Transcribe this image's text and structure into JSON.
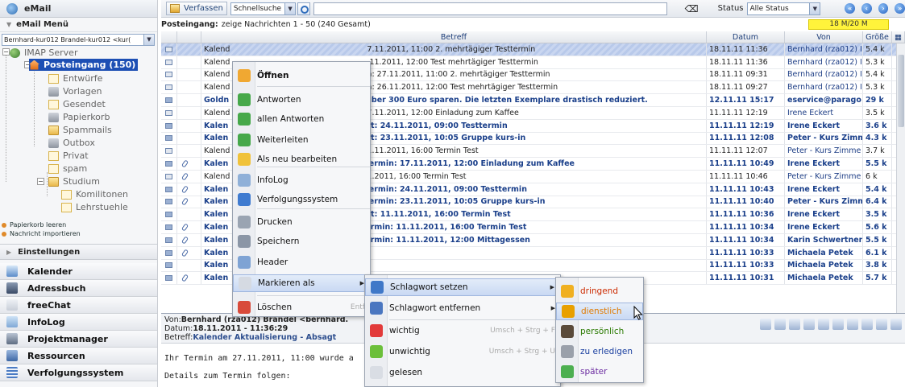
{
  "sidebar": {
    "header": "eMail",
    "menu_title": "eMail Menü",
    "account_select": "Bernhard-kur012 Brandel-kur012 <kur(",
    "tree": {
      "root": "IMAP Server",
      "inbox": "Posteingang (150)",
      "folders": [
        "Entwürfe",
        "Vorlagen",
        "Gesendet",
        "Papierkorb",
        "Spammails",
        "Outbox",
        "Privat",
        "spam",
        "Studium",
        "Komilitonen",
        "Lehrstuehle"
      ]
    },
    "links": [
      "Papierkorb leeren",
      "Nachricht importieren"
    ],
    "settings": "Einstellungen",
    "apps": [
      "Kalender",
      "Adressbuch",
      "freeChat",
      "InfoLog",
      "Projektmanager",
      "Ressourcen",
      "Verfolgungssystem"
    ]
  },
  "toolbar": {
    "compose": "Verfassen",
    "search_mode": "Schnellsuche",
    "status_label": "Status",
    "status_value": "Alle Status"
  },
  "info": {
    "folder": "Posteingang:",
    "range": "zeige Nachrichten 1 - 50 (240 Gesamt)",
    "quota": "18 M/20 M"
  },
  "columns": {
    "subject": "Betreff",
    "date": "Datum",
    "from": "Von",
    "size": "Größe"
  },
  "messages": [
    {
      "s": "Kalend",
      "m": "7.11.2011, 11:00 2. mehrtägiger Testtermin",
      "d": "18.11.11 11:36",
      "f": "Bernhard (rza012) I",
      "z": "5.4 k",
      "unread": false,
      "sel": true,
      "att": false
    },
    {
      "s": "Kalend",
      "m": ".11.2011, 12:00 Test mehrtägiger Testtermin",
      "d": "18.11.11 11:36",
      "f": "Bernhard (rza012) I",
      "z": "5.3 k",
      "unread": false,
      "sel": false,
      "att": false
    },
    {
      "s": "Kalend",
      "m": "n: 27.11.2011, 11:00 2. mehrtägiger Testtermin",
      "d": "18.11.11 09:31",
      "f": "Bernhard (rza012) I",
      "z": "5.4 k",
      "unread": false,
      "sel": false,
      "att": false
    },
    {
      "s": "Kalend",
      "m": "n: 26.11.2011, 12:00 Test mehrtägiger Testtermin",
      "d": "18.11.11 09:27",
      "f": "Bernhard (rza012) I",
      "z": "5.3 k",
      "unread": false,
      "sel": false,
      "att": false
    },
    {
      "s": "Goldn",
      "m": "über 300 Euro sparen. Die letzten Exemplare drastisch reduziert.",
      "d": "12.11.11 15:17",
      "f": "eservice@parago",
      "z": "29 k",
      "unread": true,
      "sel": false,
      "att": false
    },
    {
      "s": "Kalend",
      "m": "7.11.2011, 12:00 Einladung zum Kaffee",
      "d": "11.11.11 12:19",
      "f": "Irene Eckert",
      "z": "3.5 k",
      "unread": false,
      "sel": false,
      "att": false
    },
    {
      "s": "Kalen",
      "m": "gt: 24.11.2011, 09:00 Testtermin",
      "d": "11.11.11 12:19",
      "f": "Irene Eckert",
      "z": "3.6 k",
      "unread": true,
      "sel": false,
      "att": false
    },
    {
      "s": "Kalen",
      "m": "gt: 23.11.2011, 10:05 Gruppe kurs-in",
      "d": "11.11.11 12:08",
      "f": "Peter - Kurs Zimm",
      "z": "4.3 k",
      "unread": true,
      "sel": false,
      "att": false
    },
    {
      "s": "Kalend",
      "m": "1.11.2011, 16:00 Termin Test",
      "d": "11.11.11 12:07",
      "f": "Peter - Kurs Zimme",
      "z": "3.7 k",
      "unread": false,
      "sel": false,
      "att": false
    },
    {
      "s": "Kalen",
      "m": "termin: 17.11.2011, 12:00 Einladung zum Kaffee",
      "d": "11.11.11 10:49",
      "f": "Irene Eckert",
      "z": "5.5 k",
      "unread": true,
      "sel": false,
      "att": true
    },
    {
      "s": "Kalend",
      "m": "1.2011, 16:00 Termin Test",
      "d": "11.11.11 10:46",
      "f": "Peter - Kurs Zimme",
      "z": "6 k",
      "unread": false,
      "sel": false,
      "att": true
    },
    {
      "s": "Kalen",
      "m": "termin: 24.11.2011, 09:00 Testtermin",
      "d": "11.11.11 10:43",
      "f": "Irene Eckert",
      "z": "5.4 k",
      "unread": true,
      "sel": false,
      "att": true
    },
    {
      "s": "Kalen",
      "m": "termin: 23.11.2011, 10:05 Gruppe kurs-in",
      "d": "11.11.11 10:40",
      "f": "Peter - Kurs Zimm",
      "z": "6.4 k",
      "unread": true,
      "sel": false,
      "att": true
    },
    {
      "s": "Kalen",
      "m": "gt: 11.11.2011, 16:00 Termin Test",
      "d": "11.11.11 10:36",
      "f": "Irene Eckert",
      "z": "3.5 k",
      "unread": true,
      "sel": false,
      "att": false
    },
    {
      "s": "Kalen",
      "m": "ermin: 11.11.2011, 16:00 Termin Test",
      "d": "11.11.11 10:34",
      "f": "Irene Eckert",
      "z": "5.6 k",
      "unread": true,
      "sel": false,
      "att": true
    },
    {
      "s": "Kalen",
      "m": "ermin: 11.11.2011, 12:00 Mittagessen",
      "d": "11.11.11 10:34",
      "f": "Karin Schwertner",
      "z": "5.5 k",
      "unread": true,
      "sel": false,
      "att": true
    },
    {
      "s": "Kalen",
      "m": "",
      "d": "11.11.11 10:33",
      "f": "Michaela Petek",
      "z": "6.1 k",
      "unread": true,
      "sel": false,
      "att": true
    },
    {
      "s": "Kalen",
      "m": "",
      "d": "11.11.11 10:33",
      "f": "Michaela Petek",
      "z": "3.8 k",
      "unread": true,
      "sel": false,
      "att": false
    },
    {
      "s": "Kalen",
      "m": "",
      "d": "11.11.11 10:31",
      "f": "Michaela Petek",
      "z": "5.7 k",
      "unread": true,
      "sel": false,
      "att": true
    }
  ],
  "preview": {
    "from_label": "Von:",
    "from_value": "Bernhard (rza012) Brandel <bernhard.",
    "date_label": "Datum:",
    "date_value": "18.11.2011 - 11:36:29",
    "subject_label": "Betreff:",
    "subject_value": "Kalender Aktualisierung - Absagt",
    "body_line1": "Ihr Termin am 27.11.2011, 11:00 wurde a",
    "body_line2": "Details zum Termin folgen:"
  },
  "context_menu": [
    {
      "label": "Öffnen",
      "bold": true
    },
    {
      "label": "Antworten"
    },
    {
      "label": "allen Antworten"
    },
    {
      "label": "Weiterleiten"
    },
    {
      "label": "Als neu bearbeiten"
    },
    {
      "label": "InfoLog"
    },
    {
      "label": "Verfolgungssystem"
    },
    {
      "label": "Drucken"
    },
    {
      "label": "Speichern"
    },
    {
      "label": "Header"
    },
    {
      "label": "Markieren als"
    },
    {
      "label": "Löschen",
      "shortcut": "Entf"
    }
  ],
  "submenu": [
    {
      "label": "Schlagwort setzen"
    },
    {
      "label": "Schlagwort entfernen"
    },
    {
      "label": "wichtig",
      "shortcut": "Umsch + Strg + F"
    },
    {
      "label": "unwichtig",
      "shortcut": "Umsch + Strg + U"
    },
    {
      "label": "gelesen"
    }
  ],
  "tags": [
    {
      "label": "dringend",
      "color": "#cc2a00"
    },
    {
      "label": "dienstlich",
      "color": "#e07a00"
    },
    {
      "label": "persönlich",
      "color": "#2a7a00"
    },
    {
      "label": "zu erledigen",
      "color": "#1a3fa0"
    },
    {
      "label": "später",
      "color": "#6a2aa0"
    }
  ]
}
